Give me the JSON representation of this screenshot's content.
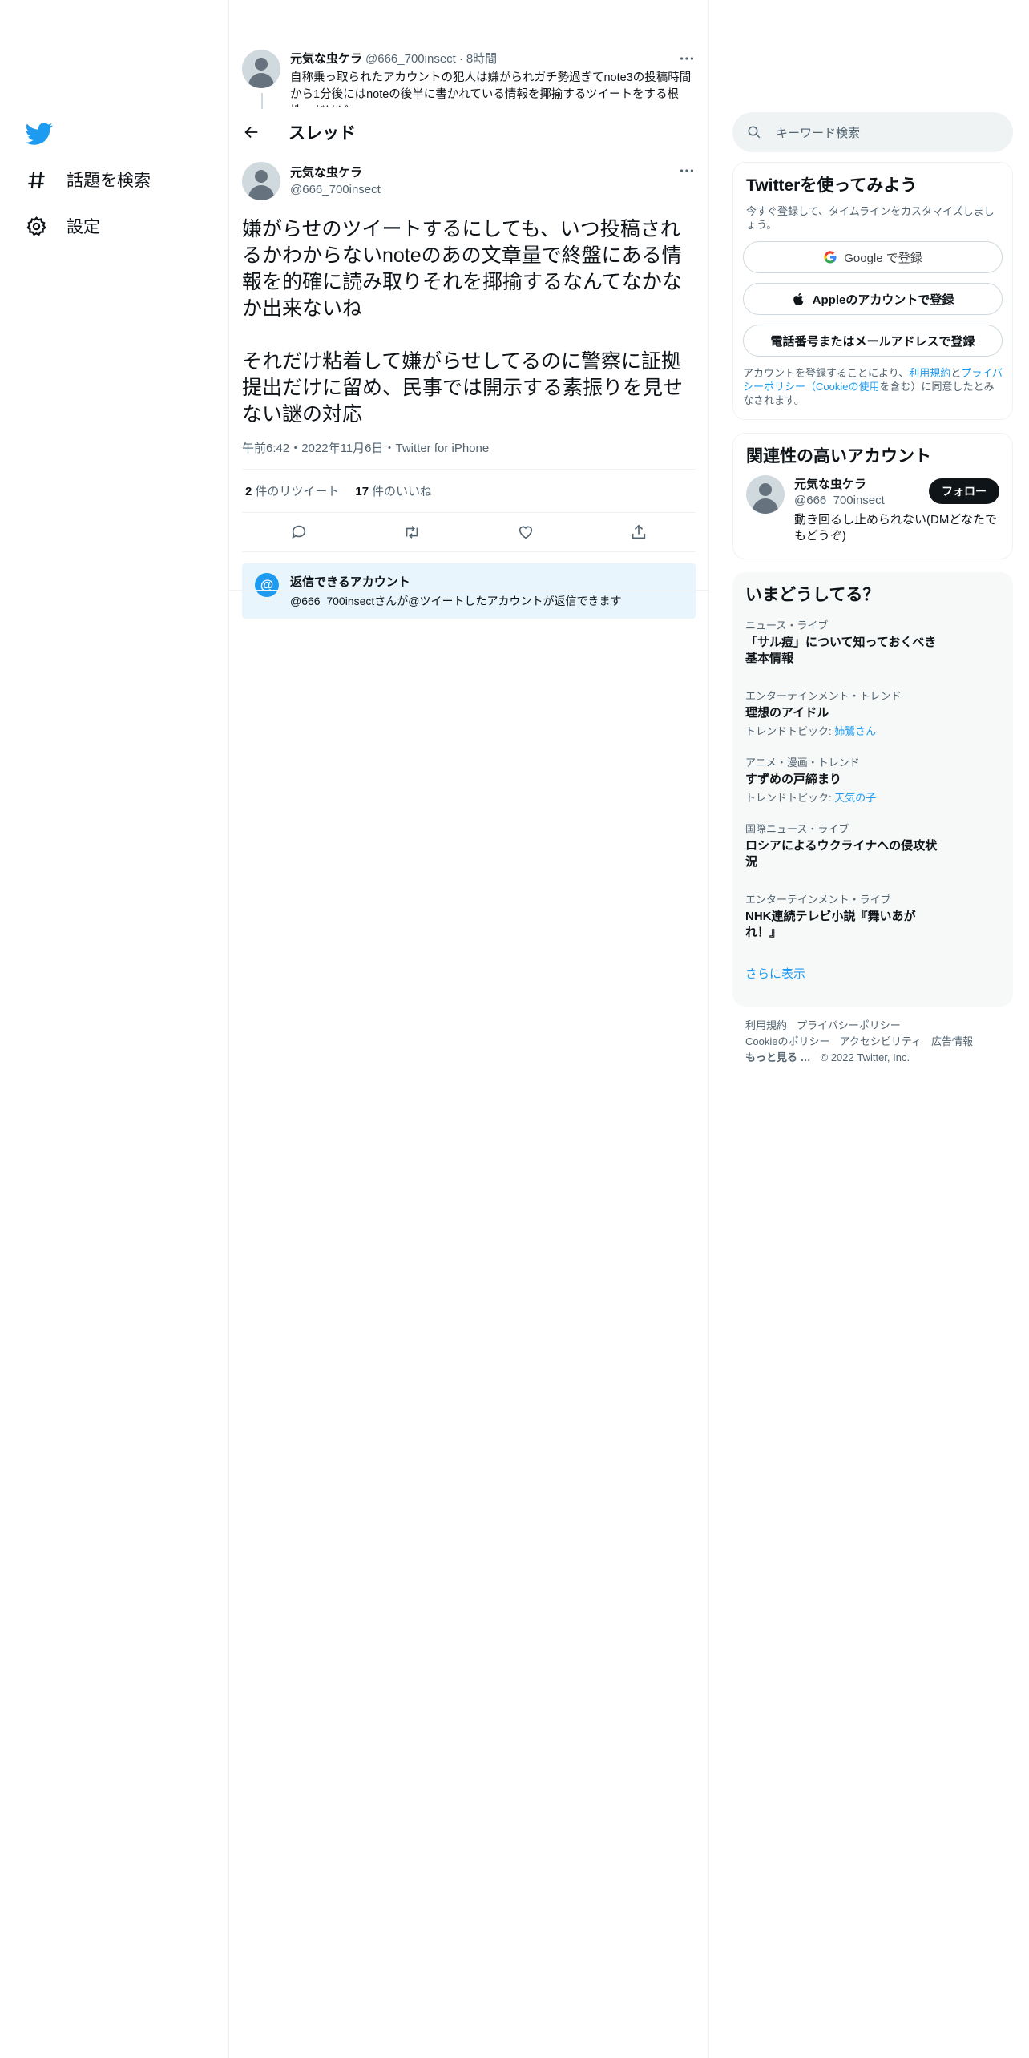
{
  "nav": {
    "explore_label": "話題を検索",
    "settings_label": "設定"
  },
  "thread_prev": {
    "name": "元気な虫ケラ",
    "handle": "@666_700insect",
    "time": "8時間",
    "text": "自称乗っ取られたアカウントの犯人は嫌がられガチ勢過ぎてnote3の投稿時間から1分後にはnoteの後半に書かれている情報を揶揄するツイートをする根性…だけど"
  },
  "header": {
    "title": "スレッド"
  },
  "tweet": {
    "name": "元気な虫ケラ",
    "handle": "@666_700insect",
    "text": "嫌がらせのツイートするにしても、いつ投稿されるかわからないnoteのあの文章量で終盤にある情報を的確に読み取りそれを揶揄するなんてなかなか出来ないね\n\nそれだけ粘着して嫌がらせしてるのに警察に証拠提出だけに留め、民事では開示する素振りを見せない謎の対応",
    "timestamp": "午前6:42・2022年11月6日・Twitter for iPhone",
    "retweets_count": "2",
    "retweets_label": "件のリツイート",
    "likes_count": "17",
    "likes_label": "件のいいね"
  },
  "reply_restriction": {
    "title": "返信できるアカウント",
    "text": "@666_700insectさんが@ツイートしたアカウントが返信できます"
  },
  "search": {
    "placeholder": "キーワード検索"
  },
  "signup": {
    "title": "Twitterを使ってみよう",
    "subtitle": "今すぐ登録して、タイムラインをカスタマイズしましょう。",
    "google_label": "Google で登録",
    "apple_label": "Appleのアカウントで登録",
    "phone_label": "電話番号またはメールアドレスで登録",
    "legal_prefix": "アカウントを登録することにより、",
    "terms": "利用規約",
    "and": "と",
    "privacy": "プライバシーポリシー",
    "open": "（",
    "cookie": "Cookieの使用",
    "legal_suffix": "を含む）に同意したとみなされます。"
  },
  "related": {
    "title": "関連性の高いアカウント",
    "name": "元気な虫ケラ",
    "handle": "@666_700insect",
    "follow_label": "フォロー",
    "bio": "動き回るし止められない(DMどなたでもどうぞ)"
  },
  "trends": {
    "title": "いまどうしてる？",
    "items": [
      {
        "category": "ニュース・ライブ",
        "title": "「サル痘」について知っておくべき基本情報",
        "topic_label": "",
        "topic": ""
      },
      {
        "category": "エンターテインメント・トレンド",
        "title": "理想のアイドル",
        "topic_label": "トレンドトピック: ",
        "topic": "姉鷺さん"
      },
      {
        "category": "アニメ・漫画・トレンド",
        "title": "すずめの戸締まり",
        "topic_label": "トレンドトピック: ",
        "topic": "天気の子"
      },
      {
        "category": "国際ニュース・ライブ",
        "title": "ロシアによるウクライナへの侵攻状況",
        "topic_label": "",
        "topic": ""
      },
      {
        "category": "エンターテインメント・ライブ",
        "title": "NHK連続テレビ小説『舞いあがれ！』",
        "topic_label": "",
        "topic": ""
      }
    ],
    "show_more": "さらに表示"
  },
  "footer": {
    "terms": "利用規約",
    "privacy": "プライバシーポリシー",
    "cookie": "Cookieのポリシー",
    "accessibility": "アクセシビリティ",
    "ads": "広告情報",
    "more": "もっと見る …",
    "copyright": "© 2022 Twitter, Inc."
  },
  "colors": {
    "accent": "#1d9bf0",
    "text": "#0f1419",
    "secondary": "#536471"
  }
}
